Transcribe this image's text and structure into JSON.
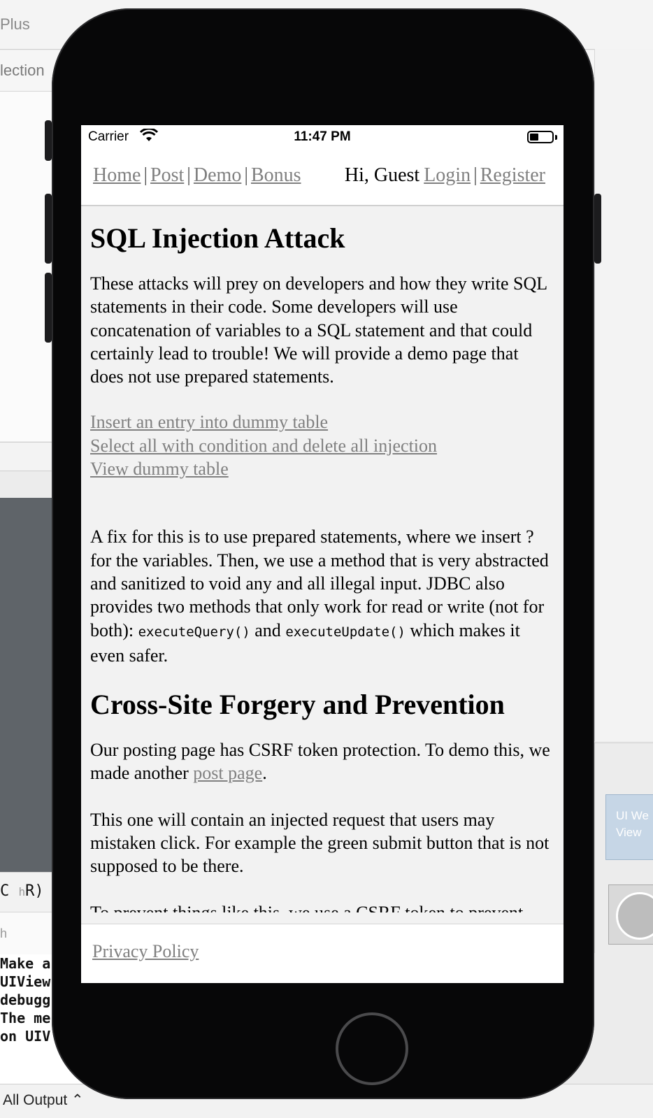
{
  "xcode": {
    "top_title_fragment": "Plus",
    "second_title_fragment": "lection",
    "debug_shortcut": {
      "prefix": "C ",
      "key": "h",
      "suffix": "R)"
    },
    "h_label": "h",
    "console_lines": [
      "Make a",
      "UIView",
      "debugg",
      "The me",
      "on UIV"
    ],
    "output_selector": "All Output",
    "ui_web_view_label": "UI We View"
  },
  "status_bar": {
    "carrier": "Carrier",
    "time": "11:47 PM",
    "battery_level": 0.4
  },
  "nav": {
    "links_left": [
      "Home",
      "Post",
      "Demo",
      "Bonus"
    ],
    "separator": "|",
    "greeting": "Hi, Guest",
    "login": "Login",
    "register": "Register"
  },
  "content": {
    "heading_sql": "SQL Injection Attack",
    "para_sql": "These attacks will prey on developers and how they write SQL statements in their code. Some developers will use concatenation of variables to a SQL statement and that could certainly lead to trouble! We will provide a demo page that does not use prepared statements.",
    "demo_links": [
      "Insert an entry into dummy table",
      "Select all with condition and delete all injection",
      "View dummy table"
    ],
    "para_fix_part1": "A fix for this is to use prepared statements, where we insert ? for the variables. Then, we use a method that is very abstracted and sanitized to void any and all illegal input. JDBC also provides two methods that only work for read or write (not for both): ",
    "code_query": "executeQuery()",
    "para_fix_and": " and ",
    "code_update": "executeUpdate()",
    "para_fix_part2": " which makes it even safer.",
    "heading_csrf": "Cross-Site Forgery and Prevention",
    "para_csrf_part1": "Our posting page has CSRF token protection. To demo this, we made another ",
    "post_page_link": "post page",
    "para_csrf_part2": ".",
    "para_inject": "This one will contain an injected request that users may mistaken click. For example the green submit button that is not supposed to be there.",
    "para_cut": "To prevent things like this, we use a CSRF token to prevent"
  },
  "footer": {
    "privacy": "Privacy Policy"
  }
}
